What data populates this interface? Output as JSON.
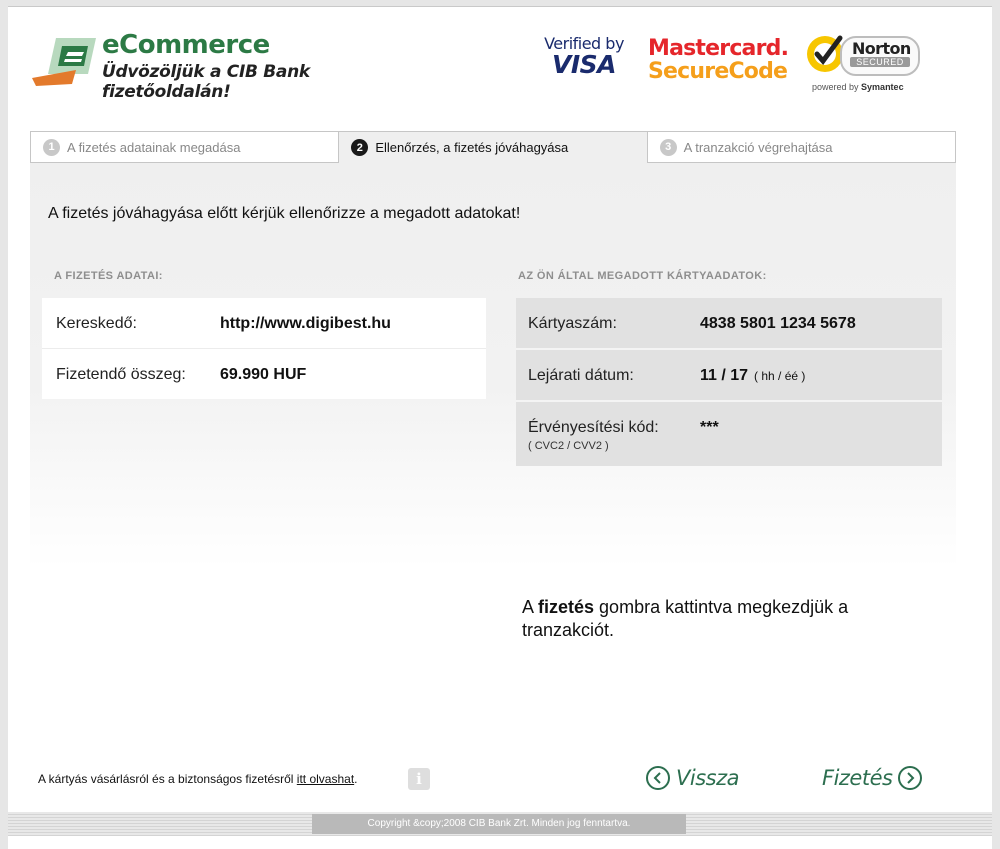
{
  "header": {
    "logo_title": "eCommerce",
    "logo_subtitle": "Üdvözöljük a CIB Bank fizetőoldalán!",
    "badges": {
      "visa_line1": "Verified by",
      "visa_line2": "VISA",
      "mc_line1": "Mastercard.",
      "mc_line2": "SecureCode",
      "norton_name": "Norton",
      "norton_secured": "SECURED",
      "norton_powered_prefix": "powered by",
      "norton_powered_brand": "Symantec"
    }
  },
  "tabs": [
    {
      "num": "1",
      "label": "A fizetés adatainak megadása",
      "active": false
    },
    {
      "num": "2",
      "label": "Ellenőrzés, a fizetés jóváhagyása",
      "active": true
    },
    {
      "num": "3",
      "label": "A tranzakció végrehajtása",
      "active": false
    }
  ],
  "panel": {
    "intro": "A fizetés jóváhagyása előtt kérjük ellenőrizze a megadott adatokat!",
    "payment_section": {
      "title": "A FIZETÉS ADATAI:",
      "rows": [
        {
          "label": "Kereskedő:",
          "value": "http://www.digibest.hu"
        },
        {
          "label": "Fizetendő összeg:",
          "value": "69.990 HUF"
        }
      ]
    },
    "card_section": {
      "title": "AZ ÖN ÁLTAL MEGADOTT KÁRTYAADATOK:",
      "card_number_label": "Kártyaszám:",
      "card_number_value": "4838 5801 1234 5678",
      "expiry_label": "Lejárati dátum:",
      "expiry_value": "11 / 17",
      "expiry_hint": "( hh / éé )",
      "cvc_label": "Érvényesítési kód:",
      "cvc_sublabel": "( CVC2 / CVV2 )",
      "cvc_value": "***"
    }
  },
  "note": {
    "prefix": "A ",
    "bold": "fizetés",
    "suffix": " gombra kattintva megkezdjük a tranzakciót."
  },
  "footer": {
    "info_text": "A kártyás vásárlásról és a biztonságos fizetésről ",
    "info_link": "itt olvashat",
    "info_end": ".",
    "info_icon": "i",
    "back_button": "Vissza",
    "pay_button": "Fizetés",
    "copyright": "Copyright &copy;2008 CIB Bank Zrt. Minden jog fenntartva."
  },
  "colors": {
    "brand_green": "#2c7a45",
    "button_green": "#2c6e4f",
    "mc_red": "#e5262b",
    "mc_orange": "#f59f1b",
    "visa_blue": "#1a2b6d",
    "norton_yellow": "#f7c600"
  }
}
